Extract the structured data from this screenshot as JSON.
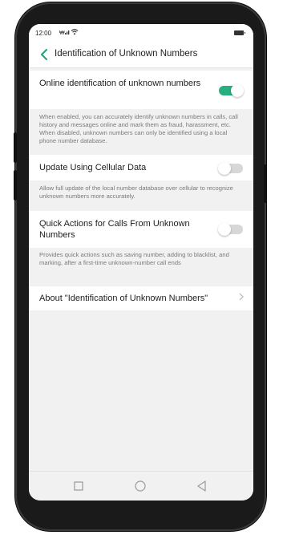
{
  "status_bar": {
    "time": "12:00",
    "signal": "ᵀˡ̇₂",
    "battery_icon": "battery-icon",
    "wifi_icon": "wifi-icon"
  },
  "header": {
    "back_icon": "back-arrow-icon",
    "title": "Identification of Unknown Numbers"
  },
  "settings": [
    {
      "label": "Online identification of unknown numbers",
      "toggle": true,
      "description": "When enabled, you can accurately identify unknown numbers in calls, call history and messages online and mark them as fraud, harassment, etc. When disabled, unknown numbers can only be identified using a local phone number database."
    },
    {
      "label": "Update Using Cellular Data",
      "toggle": false,
      "description": "Allow full update of the local number database over cellular to recognize unknown numbers more accurately."
    },
    {
      "label": "Quick Actions for Calls From Unknown Numbers",
      "toggle": false,
      "description": "Provides quick actions such as saving number, adding to blacklist, and marking, after a first-time unknown-number call ends"
    }
  ],
  "about": {
    "label": "About \"Identification of Unknown Numbers\"",
    "chevron_icon": "chevron-right-icon"
  },
  "nav_bar": {
    "recent_icon": "square-icon",
    "home_icon": "circle-icon",
    "back_icon": "triangle-back-icon"
  },
  "colors": {
    "accent": "#27b07f",
    "toggle_off": "#d7d7d7",
    "screen_bg": "#f1f1f1"
  }
}
